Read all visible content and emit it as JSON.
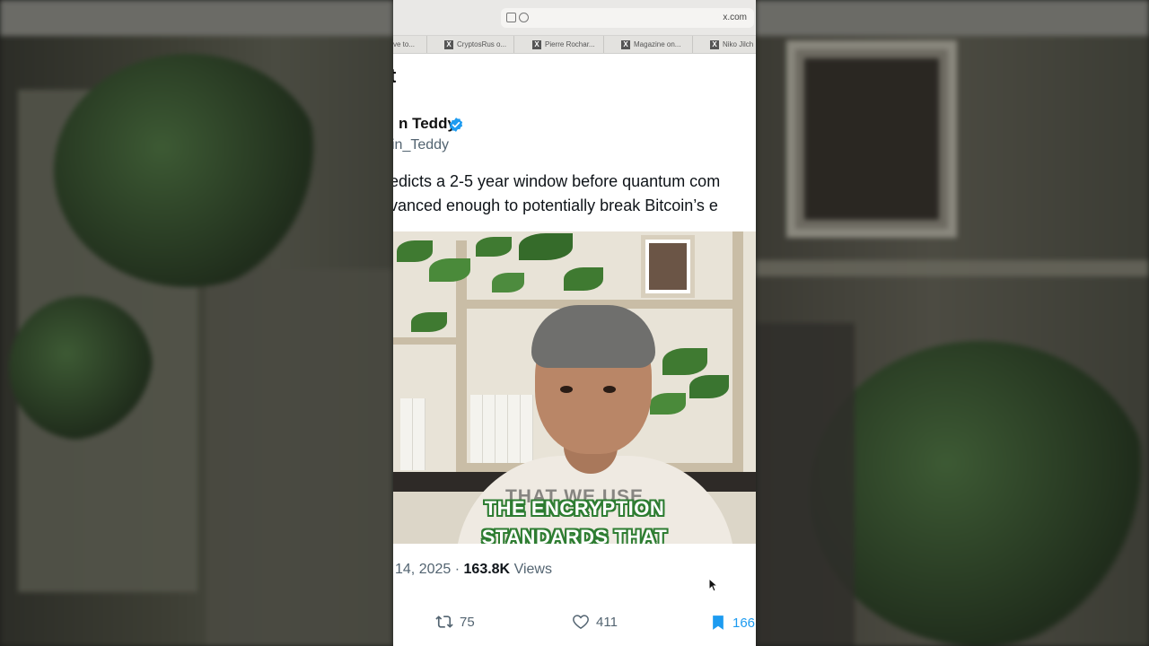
{
  "browser": {
    "url": "x.com",
    "tabs": [
      {
        "label": "ve to..."
      },
      {
        "label": "CryptosRus o..."
      },
      {
        "label": "Pierre Rochar..."
      },
      {
        "label": "Magazine on..."
      },
      {
        "label": "Niko Jilch"
      }
    ]
  },
  "post": {
    "back_fragment": "t",
    "author_name": "n Teddy",
    "author_handle": "in_Teddy",
    "text_line_1": "edicts a 2-5 year window before quantum com",
    "text_line_2": "vanced enough to potentially break Bitcoin’s e",
    "date": "14, 2025",
    "separator": "·",
    "views_count": "163.8K",
    "views_label": "Views"
  },
  "video": {
    "caption_ghost": "THAT WE USE",
    "caption_line_1": "THE ENCRYPTION",
    "caption_line_2": "STANDARDS THAT"
  },
  "actions": {
    "retweets": "75",
    "likes": "411",
    "bookmarks": "166"
  },
  "colors": {
    "caption_outline": "#2e7d32",
    "verified_blue": "#1d9bf0",
    "muted_text": "#536471"
  }
}
